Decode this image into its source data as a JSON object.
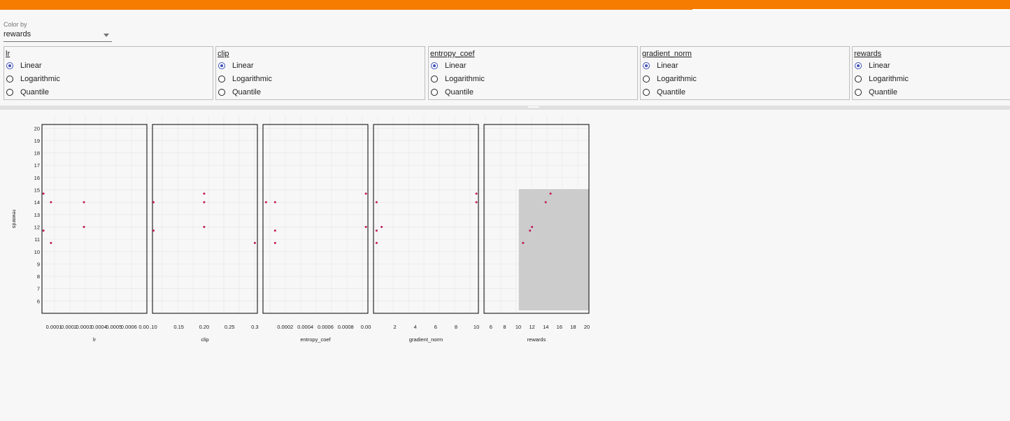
{
  "color_by": {
    "label": "Color by",
    "value": "rewards"
  },
  "scale_options": [
    "Linear",
    "Logarithmic",
    "Quantile"
  ],
  "scales": [
    {
      "name": "lr",
      "selected": "Linear"
    },
    {
      "name": "clip",
      "selected": "Linear"
    },
    {
      "name": "entropy_coef",
      "selected": "Linear"
    },
    {
      "name": "gradient_norm",
      "selected": "Linear"
    },
    {
      "name": "rewards",
      "selected": "Linear"
    }
  ],
  "colors": {
    "accent": "#f57c00",
    "radio": "#3f51b5",
    "point": "#c2185b",
    "selection": "#cccccc"
  },
  "chart_data": {
    "type": "scatter",
    "y_axis": {
      "label": "rewards",
      "ticks": [
        "20",
        "19",
        "18",
        "17",
        "16",
        "15",
        "14",
        "13",
        "12",
        "11",
        "10",
        "9",
        "8",
        "7",
        "6"
      ],
      "range": [
        5,
        20.3
      ]
    },
    "grid": true,
    "panels": [
      {
        "xlabel": "lr",
        "ticks": [
          "0.0001",
          "0.0002",
          "0.0003",
          "0.0004",
          "0.0005",
          "0.0006",
          "0.00"
        ],
        "tick_values": [
          0.0001,
          0.0002,
          0.0003,
          0.0004,
          0.0005,
          0.0006,
          0.0007
        ],
        "range": [
          2e-05,
          0.00072
        ],
        "points": [
          [
            3e-05,
            14.7
          ],
          [
            3e-05,
            11.7
          ],
          [
            8e-05,
            14
          ],
          [
            8e-05,
            10.7
          ],
          [
            0.0003,
            14
          ],
          [
            0.0003,
            12
          ]
        ]
      },
      {
        "xlabel": "clip",
        "ticks": [
          ".10",
          "0.15",
          "0.20",
          "0.25",
          "0.3"
        ],
        "tick_values": [
          0.1,
          0.15,
          0.2,
          0.25,
          0.3
        ],
        "range": [
          0.098,
          0.305
        ],
        "points": [
          [
            0.1,
            14
          ],
          [
            0.1,
            11.7
          ],
          [
            0.2,
            14.7
          ],
          [
            0.2,
            14
          ],
          [
            0.2,
            12
          ],
          [
            0.3,
            10.7
          ]
        ]
      },
      {
        "xlabel": "entropy_coef",
        "ticks": [
          "0.0002",
          "0.0004",
          "0.0006",
          "0.0008",
          "0.00"
        ],
        "tick_values": [
          0.0002,
          0.0004,
          0.0006,
          0.0008,
          0.001
        ],
        "range": [
          -2e-05,
          0.00102
        ],
        "points": [
          [
            1e-05,
            14
          ],
          [
            0.0001,
            14
          ],
          [
            0.0001,
            11.7
          ],
          [
            0.0001,
            10.7
          ],
          [
            0.001,
            14.7
          ],
          [
            0.001,
            12
          ]
        ]
      },
      {
        "xlabel": "gradient_norm",
        "ticks": [
          "2",
          "4",
          "6",
          "8",
          "10"
        ],
        "tick_values": [
          2,
          4,
          6,
          8,
          10
        ],
        "range": [
          -0.1,
          10.2
        ],
        "points": [
          [
            0.2,
            14
          ],
          [
            0.2,
            11.7
          ],
          [
            0.2,
            10.7
          ],
          [
            0.7,
            12
          ],
          [
            10,
            14.7
          ],
          [
            10,
            14
          ]
        ]
      },
      {
        "xlabel": "rewards",
        "ticks": [
          "6",
          "8",
          "10",
          "12",
          "14",
          "16",
          "18",
          "20"
        ],
        "tick_values": [
          6,
          8,
          10,
          12,
          14,
          16,
          18,
          20
        ],
        "range": [
          5,
          20.3
        ],
        "points": [
          [
            10.7,
            10.7
          ],
          [
            11.7,
            11.7
          ],
          [
            12,
            12
          ],
          [
            14,
            14
          ],
          [
            14.7,
            14.7
          ]
        ],
        "selection": {
          "x": [
            10,
            20.3
          ],
          "y": [
            5.2,
            15.1
          ]
        }
      }
    ]
  }
}
